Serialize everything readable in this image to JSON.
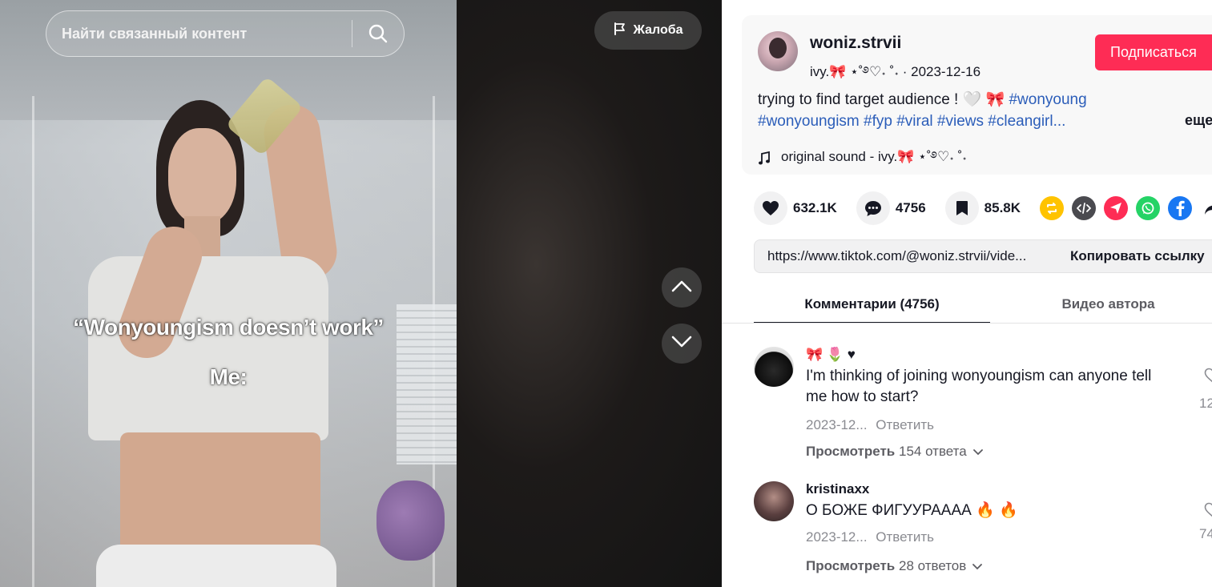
{
  "search": {
    "placeholder": "Найти связанный контент"
  },
  "report": {
    "label": "Жалоба"
  },
  "video": {
    "overlay_line1": "“Wonyoungism doesn’t work”",
    "overlay_line2": "Me:"
  },
  "author": {
    "username": "woniz.strvii",
    "nickname": "ivy.🎀 ⋆˚࿔♡˖ ˚˖",
    "date": "2023-12-16",
    "follow_label": "Подписаться"
  },
  "description": {
    "text": "trying to find target audience ! 🤍 🎀",
    "hashtags": [
      "#wonyoung",
      "#wonyoungism",
      "#fyp",
      "#viral",
      "#views",
      "#cleangirl..."
    ],
    "more_label": "еще"
  },
  "music": {
    "label": "original sound - ivy.🎀 ⋆˚࿔♡˖ ˚˖"
  },
  "stats": {
    "likes": "632.1K",
    "comments": "4756",
    "saves": "85.8K"
  },
  "link": {
    "url": "https://www.tiktok.com/@woniz.strvii/vide...",
    "copy_label": "Копировать ссылку"
  },
  "tabs": [
    {
      "label": "Комментарии (4756)",
      "active": true
    },
    {
      "label": "Видео автора",
      "active": false
    }
  ],
  "comments": [
    {
      "user": "🎀 🌷 ♥",
      "text": "I'm thinking of joining wonyoungism can anyone tell me how to start?",
      "date": "2023-12...",
      "reply_label": "Ответить",
      "view_replies_label": "Просмотреть",
      "replies_count": "154 ответа",
      "likes": "12"
    },
    {
      "user": "kristinaxx",
      "text": "О БОЖЕ ФИГУУРАААА 🔥 🔥",
      "date": "2023-12...",
      "reply_label": "Ответить",
      "view_replies_label": "Просмотреть",
      "replies_count": "28 ответов",
      "likes": "74"
    }
  ],
  "colors": {
    "accent": "#fe2c55",
    "hashtag": "#2b5db9",
    "repost": "#ffc300",
    "embed": "#4a4a4f",
    "send": "#fe2c55",
    "whatsapp": "#25d366",
    "facebook": "#1877f2"
  }
}
